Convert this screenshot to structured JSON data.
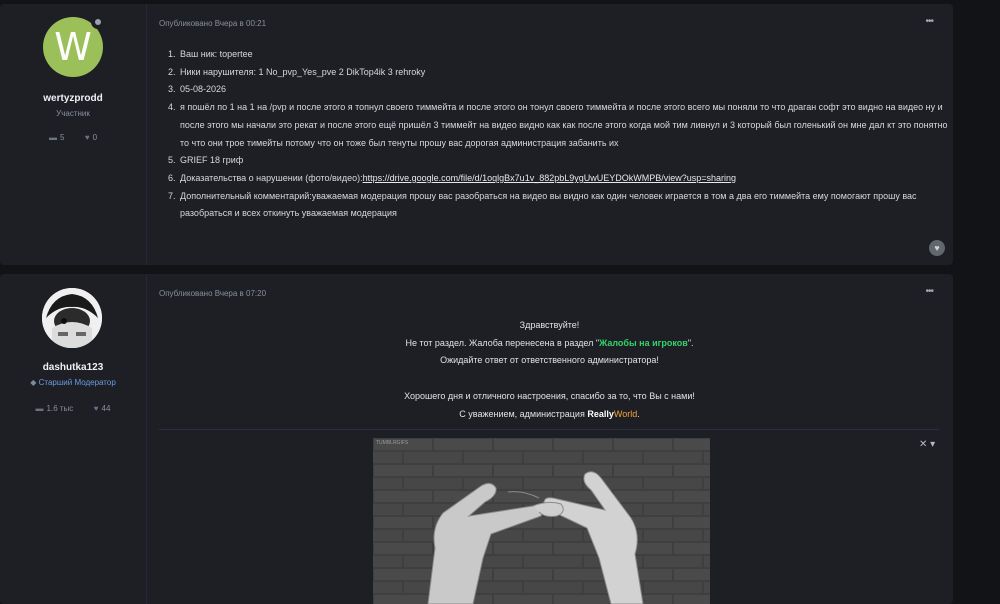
{
  "posts": [
    {
      "author": {
        "avatar_letter": "W",
        "avatar_color": "#9bc05a",
        "name": "wertyzprodd",
        "role": "Участник",
        "comments_count": "5",
        "likes_count": "0"
      },
      "date": "Опубликовано Вчера в 00:21",
      "menu_icon": "ellipsis-icon",
      "fields": [
        {
          "label": "Ваш ник: topertee"
        },
        {
          "label": "Ники нарушителя: 1 No_pvp_Yes_pve 2 DikTop4ik 3 rehroky"
        },
        {
          "label": "05-08-2026"
        },
        {
          "label": "я пошёл по 1 на 1 на /pvp и после этого я топнул своего тиммейта и после этого он тонул своего тиммейта и после этого всего мы поняли то что драган софт это видно на видео ну и после этого мы начали это рекат и после этого ещё пришёл 3 тиммейт на видео видно как как после этого когда мой тим ливнул и 3 который был голенький он мне дал кт это понятно то что они трое тимейты потому что он тоже был тенуты прошу вас дорогая администрация забанить их"
        },
        {
          "label": "GRIEF 18 гриф"
        },
        {
          "label_prefix": "Доказательства о нарушении (фото/видео):",
          "link": "https://drive.google.com/file/d/1oqlgBx7u1v_882pbL9ygUwUEYDOkWMPB/view?usp=sharing"
        },
        {
          "label": "Дополнительный комментарий:уважаемая модерация прошу вас разобраться на видео вы видно как один человек играется в том а два его тиммейта ему помогают прошу вас разобраться и всех откинуть уважаемая модерация"
        }
      ]
    },
    {
      "author": {
        "name": "dashutka123",
        "role": "Старший Модератор",
        "role_color": "#6f9be0",
        "comments_count": "1.6 тыс",
        "likes_count": "44"
      },
      "date": "Опубликовано Вчера в 07:20",
      "menu_icon": "ellipsis-icon",
      "message": {
        "line1": "Здравствуйте!",
        "line2_prefix": "Не тот раздел. Жалоба перенесена в раздел \"",
        "line2_link": "Жалобы на игроков",
        "line2_suffix": "\".",
        "line3": "Ожидайте ответ от ответственного администратора!",
        "line5": "Хорошего дня и отличного настроения, спасибо за то, что Вы с нами!",
        "line6_prefix": "С уважением, администрация ",
        "brand_a": "Really",
        "brand_b": "World",
        "line6_suffix": ".",
        "green": "#33d36a",
        "orange": "#f2a53a"
      },
      "gif_tag": "TUMBLRGIFS"
    }
  ]
}
